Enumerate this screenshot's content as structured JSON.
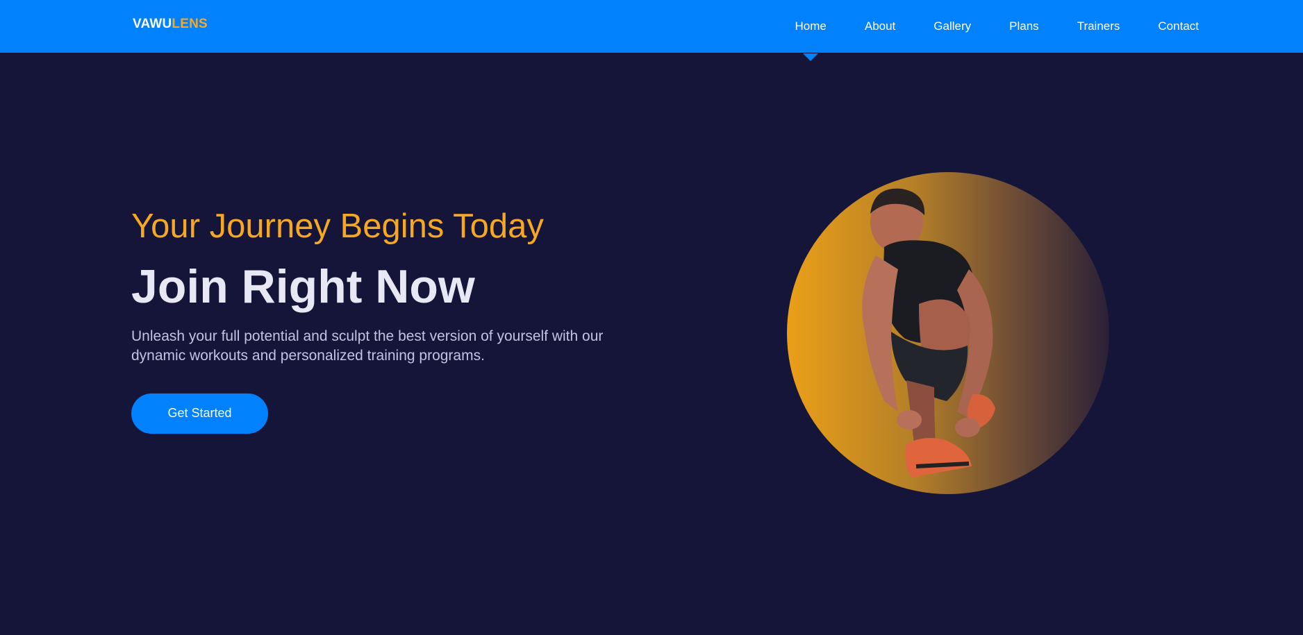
{
  "brand": {
    "logo_main": "VAWU",
    "logo_accent": "LENS"
  },
  "nav": {
    "items": [
      {
        "label": "Home",
        "active": true
      },
      {
        "label": "About",
        "active": false
      },
      {
        "label": "Gallery",
        "active": false
      },
      {
        "label": "Plans",
        "active": false
      },
      {
        "label": "Trainers",
        "active": false
      },
      {
        "label": "Contact",
        "active": false
      }
    ]
  },
  "hero": {
    "subtitle": "Your Journey Begins Today",
    "title": "Join Right Now",
    "description": "Unleash your full potential and sculpt the best version of yourself with our dynamic workouts and personalized training programs.",
    "cta_label": "Get Started"
  },
  "colors": {
    "nav_background": "#0181fc",
    "page_background": "#141538",
    "accent": "#f7a823",
    "button": "#0181fc"
  }
}
